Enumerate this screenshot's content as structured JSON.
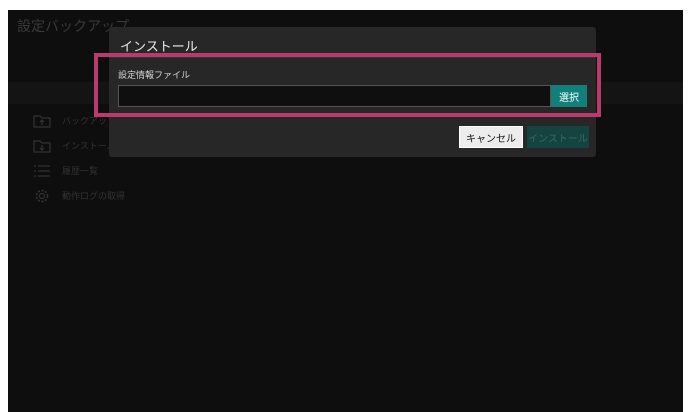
{
  "app": {
    "background_title": "設定バックアップ",
    "menu": [
      {
        "label": "バックアップ",
        "icon": "upload-folder-icon"
      },
      {
        "label": "インストール",
        "icon": "download-folder-icon"
      },
      {
        "label": "履歴一覧",
        "icon": "list-icon"
      },
      {
        "label": "動作ログの取得",
        "icon": "gear-icon"
      }
    ]
  },
  "dialog": {
    "title": "インストール",
    "field_label": "設定情報ファイル",
    "file_value": "",
    "select_label": "選択",
    "cancel_label": "キャンセル",
    "install_label": "インストール"
  },
  "colors": {
    "accent": "#11807a",
    "highlight": "#bb3a6e",
    "dialog_bg": "#272727"
  }
}
